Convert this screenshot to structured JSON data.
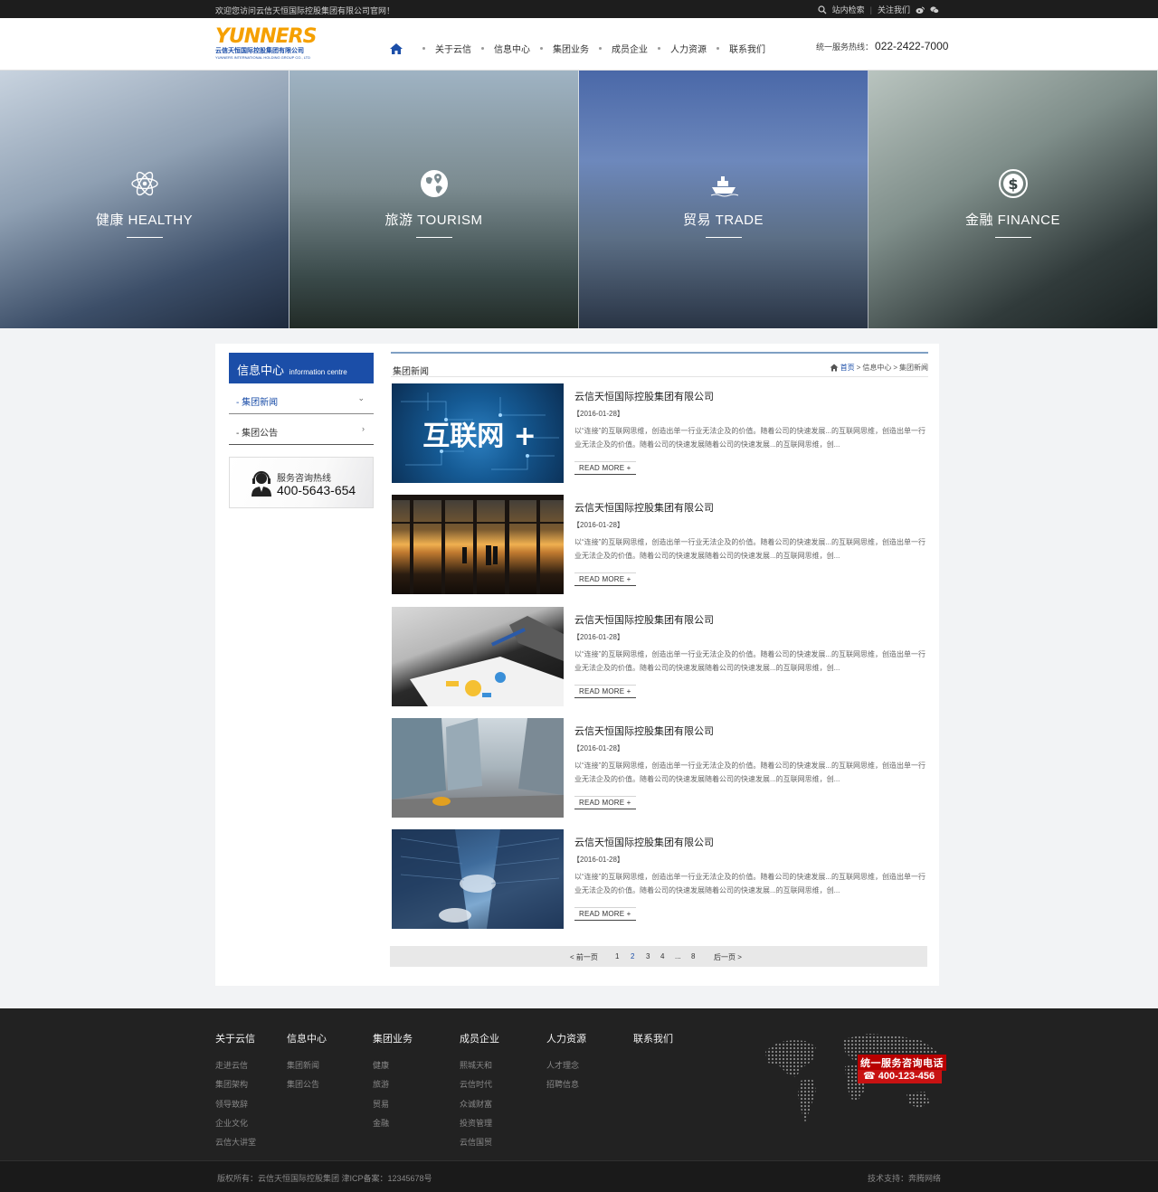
{
  "topbar": {
    "welcome": "欢迎您访问云信天恒国际控股集团有限公司官网！",
    "search_label": "站内检索",
    "follow_label": "关注我们"
  },
  "header": {
    "logo_text": "YUNNERS",
    "logo_cn": "云信天恒国际控股集团有限公司",
    "logo_en": "YUNNERS INTERNATIONAL HOLDING GROUP CO., LTD",
    "nav": [
      "关于云信",
      "信息中心",
      "集团业务",
      "成员企业",
      "人力资源",
      "联系我们"
    ],
    "hotline_label": "统一服务热线：",
    "hotline_number": "022-2422-7000"
  },
  "banner": [
    {
      "label": "健康 HEALTHY",
      "icon": "atom-icon"
    },
    {
      "label": "旅游 TOURISM",
      "icon": "globe-pin-icon"
    },
    {
      "label": "贸易 TRADE",
      "icon": "ship-icon"
    },
    {
      "label": "金融 FINANCE",
      "icon": "dollar-icon"
    }
  ],
  "sidebar": {
    "title": "信息中心",
    "title_en": "information centre",
    "items": [
      {
        "label": "集团新闻",
        "arrow": "⌄"
      },
      {
        "label": "集团公告",
        "arrow": "›"
      }
    ],
    "service_title": "服务咨询热线",
    "service_number": "400-5643-654"
  },
  "main": {
    "section_title": "集团新闻",
    "breadcrumb": [
      "首页",
      "信息中心",
      "集团新闻"
    ],
    "news": [
      {
        "title": "云信天恒国际控股集团有限公司",
        "date": "【2016-01-28】",
        "summary": "以“连接”的互联网思维，创造出单一行业无法企及的价值。随着公司的快速发展...的互联网思维，创造出单一行业无法企及的价值。随着公司的快速发展随着公司的快速发展...的互联网思维，创...",
        "more": "READ MORE +",
        "thumb": "互联网 +"
      },
      {
        "title": "云信天恒国际控股集团有限公司",
        "date": "【2016-01-28】",
        "summary": "以“连接”的互联网思维，创造出单一行业无法企及的价值。随着公司的快速发展...的互联网思维，创造出单一行业无法企及的价值。随着公司的快速发展随着公司的快速发展...的互联网思维，创...",
        "more": "READ MORE +",
        "thumb": ""
      },
      {
        "title": "云信天恒国际控股集团有限公司",
        "date": "【2016-01-28】",
        "summary": "以“连接”的互联网思维，创造出单一行业无法企及的价值。随着公司的快速发展...的互联网思维，创造出单一行业无法企及的价值。随着公司的快速发展随着公司的快速发展...的互联网思维，创...",
        "more": "READ MORE +",
        "thumb": ""
      },
      {
        "title": "云信天恒国际控股集团有限公司",
        "date": "【2016-01-28】",
        "summary": "以“连接”的互联网思维，创造出单一行业无法企及的价值。随着公司的快速发展...的互联网思维，创造出单一行业无法企及的价值。随着公司的快速发展随着公司的快速发展...的互联网思维，创...",
        "more": "READ MORE +",
        "thumb": ""
      },
      {
        "title": "云信天恒国际控股集团有限公司",
        "date": "【2016-01-28】",
        "summary": "以“连接”的互联网思维，创造出单一行业无法企及的价值。随着公司的快速发展...的互联网思维，创造出单一行业无法企及的价值。随着公司的快速发展随着公司的快速发展...的互联网思维，创...",
        "more": "READ MORE +",
        "thumb": ""
      }
    ],
    "pager": {
      "prev": "< 前一页",
      "pages": [
        "1",
        "2",
        "3",
        "4",
        "...",
        "8"
      ],
      "current": "2",
      "next": "后一页 >"
    }
  },
  "footer": {
    "columns": [
      {
        "heading": "关于云信",
        "links": [
          "走进云信",
          "集团架构",
          "领导致辞",
          "企业文化",
          "云信大讲堂"
        ]
      },
      {
        "heading": "信息中心",
        "links": [
          "集团新闻",
          "集团公告"
        ]
      },
      {
        "heading": "集团业务",
        "links": [
          "健康",
          "旅游",
          "贸易",
          "金融"
        ]
      },
      {
        "heading": "成员企业",
        "links": [
          "熙城天和",
          "云信时代",
          "众诚财富",
          "投资管理",
          "云信国贸"
        ]
      },
      {
        "heading": "人力资源",
        "links": [
          "人才理念",
          "招聘信息"
        ]
      },
      {
        "heading": "联系我们",
        "links": []
      }
    ],
    "cta_title": "统一服务咨询电话",
    "cta_number": "400-123-456",
    "copyright": "版权所有：云信天恒国际控股集团 津ICP备案：12345678号",
    "tech_support": "技术支持：奔腾网络"
  },
  "colors": {
    "brand_blue": "#1b4ea8",
    "logo_orange": "#f5a000",
    "footer_bg": "#222222",
    "cta_red": "#c81212"
  }
}
